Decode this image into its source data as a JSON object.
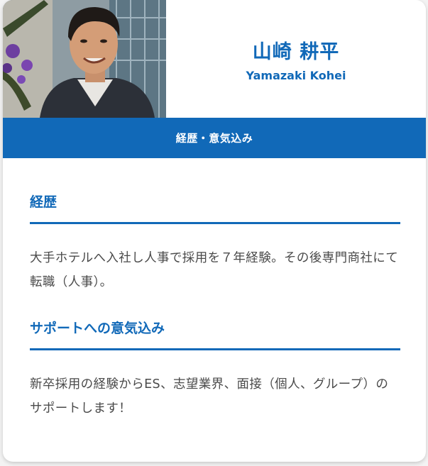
{
  "profile": {
    "name_ja": "山崎 耕平",
    "name_en": "Yamazaki Kohei",
    "photo_icon": "profile-photo"
  },
  "band": {
    "label": "経歴・意気込み"
  },
  "sections": [
    {
      "heading": "経歴",
      "text": "大手ホテルへ入社し人事で採用を７年経験。その後専門商社にて転職（人事）。"
    },
    {
      "heading": "サポートへの意気込み",
      "text": "新卒採用の経験からES、志望業界、面接（個人、グループ）のサポートします！"
    }
  ],
  "colors": {
    "accent": "#1169b8",
    "text": "#4a4a4a",
    "background": "#ffffff"
  }
}
